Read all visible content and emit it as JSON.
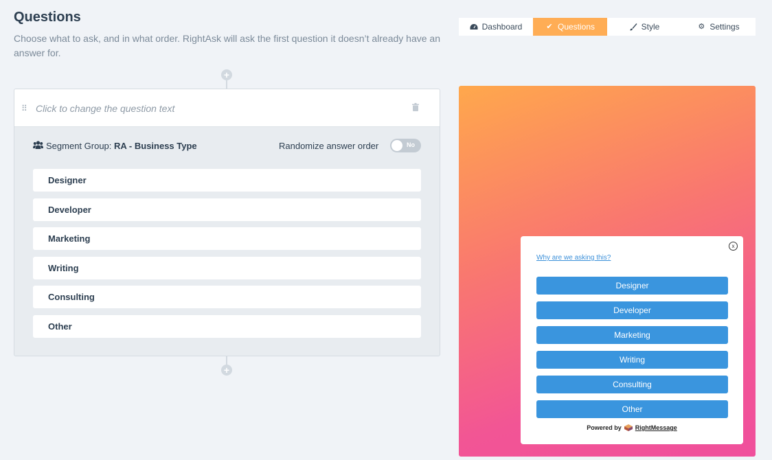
{
  "header": {
    "title": "Questions",
    "description": "Choose what to ask, and in what order. RightAsk will ask the first question it doesn’t already have an answer for."
  },
  "nav": {
    "tabs": [
      {
        "label": "Dashboard",
        "icon": "dashboard-icon",
        "active": false
      },
      {
        "label": "Questions",
        "icon": "check-icon",
        "active": true
      },
      {
        "label": "Style",
        "icon": "brush-icon",
        "active": false
      },
      {
        "label": "Settings",
        "icon": "gear-icon",
        "active": false
      }
    ]
  },
  "question": {
    "placeholder": "Click to change the question text",
    "segment_prefix": "Segment Group:",
    "segment_name": "RA - Business Type",
    "randomize_label": "Randomize answer order",
    "randomize_value": "No",
    "answers": [
      "Designer",
      "Developer",
      "Marketing",
      "Writing",
      "Consulting",
      "Other"
    ]
  },
  "preview": {
    "close_label": "x",
    "why_link": "Why are we asking this?",
    "buttons": [
      "Designer",
      "Developer",
      "Marketing",
      "Writing",
      "Consulting",
      "Other"
    ],
    "powered_by": "Powered by",
    "brand": "RightMessage"
  },
  "colors": {
    "accent": "#ffad55",
    "widget_button": "#3a95de",
    "gradient_start": "#ffa84c",
    "gradient_end": "#f04f9c"
  }
}
